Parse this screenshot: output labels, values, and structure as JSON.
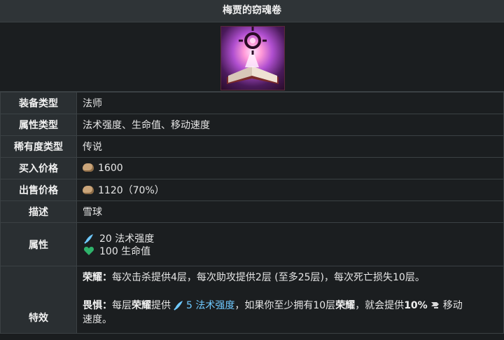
{
  "header": {
    "title": "梅贾的窃魂卷"
  },
  "rows": {
    "type": {
      "label": "装备类型",
      "value": "法师"
    },
    "stats_type": {
      "label": "属性类型",
      "value": "法术强度、生命值、移动速度"
    },
    "rarity": {
      "label": "稀有度类型",
      "value": "传说"
    },
    "buy": {
      "label": "买入价格",
      "value": "1600"
    },
    "sell": {
      "label": "出售价格",
      "value": "1120（70%）"
    },
    "desc": {
      "label": "描述",
      "value": "雪球"
    },
    "attrs": {
      "label": "属性",
      "items": [
        {
          "icon": "ability-power-icon",
          "text": "20 法术强度"
        },
        {
          "icon": "health-heart-icon",
          "text": "100 生命值"
        }
      ]
    },
    "effects": {
      "label": "特效",
      "glory_title": "荣耀：",
      "glory_text": "每次击杀提供4层，每次助攻提供2层 (至多25层)，每次死亡损失10层。",
      "dread_title": "畏惧：",
      "dread_t1": "每层",
      "dread_k1": "荣耀",
      "dread_t2": "提供",
      "dread_ap": "5 法术强度",
      "dread_t3": "，如果你至少拥有10层",
      "dread_k2": "荣耀",
      "dread_t4": "，就会提供",
      "dread_pct": "10%",
      "dread_t5": "移动",
      "dread_t6": "速度。"
    }
  },
  "colors": {
    "label_bg": "#2a2f32",
    "value_bg": "#1b1e20",
    "ap_blue": "#6fc9ff",
    "health_green": "#2fb36b",
    "gold": "#caa57a"
  }
}
